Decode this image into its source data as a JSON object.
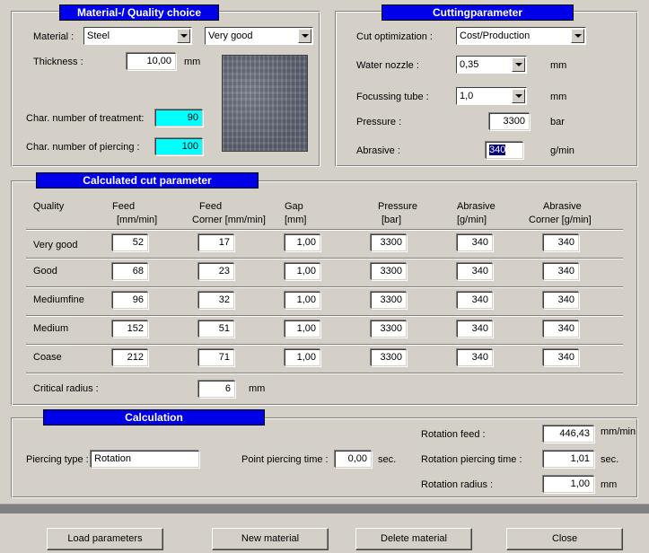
{
  "material_panel": {
    "title": "Material-/ Quality choice",
    "material_label": "Material :",
    "material_value": "Steel",
    "quality_value": "Very good",
    "thickness_label": "Thickness :",
    "thickness_value": "10,00",
    "thickness_unit": "mm",
    "treatment_label": "Char. number of treatment:",
    "treatment_value": "90",
    "piercing_label": "Char. number of piercing :",
    "piercing_value": "100"
  },
  "cutting_panel": {
    "title": "Cuttingparameter",
    "optimization_label": "Cut optimization :",
    "optimization_value": "Cost/Production",
    "nozzle_label": "Water nozzle :",
    "nozzle_value": "0,35",
    "nozzle_unit": "mm",
    "tube_label": "Focussing tube :",
    "tube_value": "1,0",
    "tube_unit": "mm",
    "pressure_label": "Pressure :",
    "pressure_value": "3300",
    "pressure_unit": "bar",
    "abrasive_label": "Abrasive :",
    "abrasive_value": "340",
    "abrasive_unit": "g/min"
  },
  "calc_panel": {
    "title": "Calculated cut parameter",
    "headers": [
      {
        "top": "Quality",
        "bottom": ""
      },
      {
        "top": "Feed",
        "bottom": "[mm/min]"
      },
      {
        "top": "Feed",
        "bottom": "Corner  [mm/min]"
      },
      {
        "top": "Gap",
        "bottom": "[mm]"
      },
      {
        "top": "Pressure",
        "bottom": "[bar]"
      },
      {
        "top": "Abrasive",
        "bottom": "[g/min]"
      },
      {
        "top": "Abrasive",
        "bottom": "Corner   [g/min]"
      }
    ],
    "rows": [
      {
        "quality": "Very good",
        "feed": "52",
        "corner": "17",
        "gap": "1,00",
        "pressure": "3300",
        "abrasive": "340",
        "abr_corner": "340"
      },
      {
        "quality": "Good",
        "feed": "68",
        "corner": "23",
        "gap": "1,00",
        "pressure": "3300",
        "abrasive": "340",
        "abr_corner": "340"
      },
      {
        "quality": "Mediumfine",
        "feed": "96",
        "corner": "32",
        "gap": "1,00",
        "pressure": "3300",
        "abrasive": "340",
        "abr_corner": "340"
      },
      {
        "quality": "Medium",
        "feed": "152",
        "corner": "51",
        "gap": "1,00",
        "pressure": "3300",
        "abrasive": "340",
        "abr_corner": "340"
      },
      {
        "quality": "Coase",
        "feed": "212",
        "corner": "71",
        "gap": "1,00",
        "pressure": "3300",
        "abrasive": "340",
        "abr_corner": "340"
      }
    ],
    "critical_label": "Critical radius :",
    "critical_value": "6",
    "critical_unit": "mm"
  },
  "calculation_panel": {
    "title": "Calculation",
    "piercing_type_label": "Piercing type :",
    "piercing_type_value": "Rotation",
    "point_label": "Point piercing time :",
    "point_value": "0,00",
    "point_unit": "sec.",
    "rot_feed_label": "Rotation feed :",
    "rot_feed_value": "446,43",
    "rot_feed_unit": "mm/min",
    "rot_pierce_label": "Rotation piercing time :",
    "rot_pierce_value": "1,01",
    "rot_pierce_unit": "sec.",
    "rot_radius_label": "Rotation radius :",
    "rot_radius_value": "1,00",
    "rot_radius_unit": "mm"
  },
  "buttons": {
    "load": "Load parameters",
    "new": "New material",
    "delete": "Delete material",
    "close": "Close"
  }
}
